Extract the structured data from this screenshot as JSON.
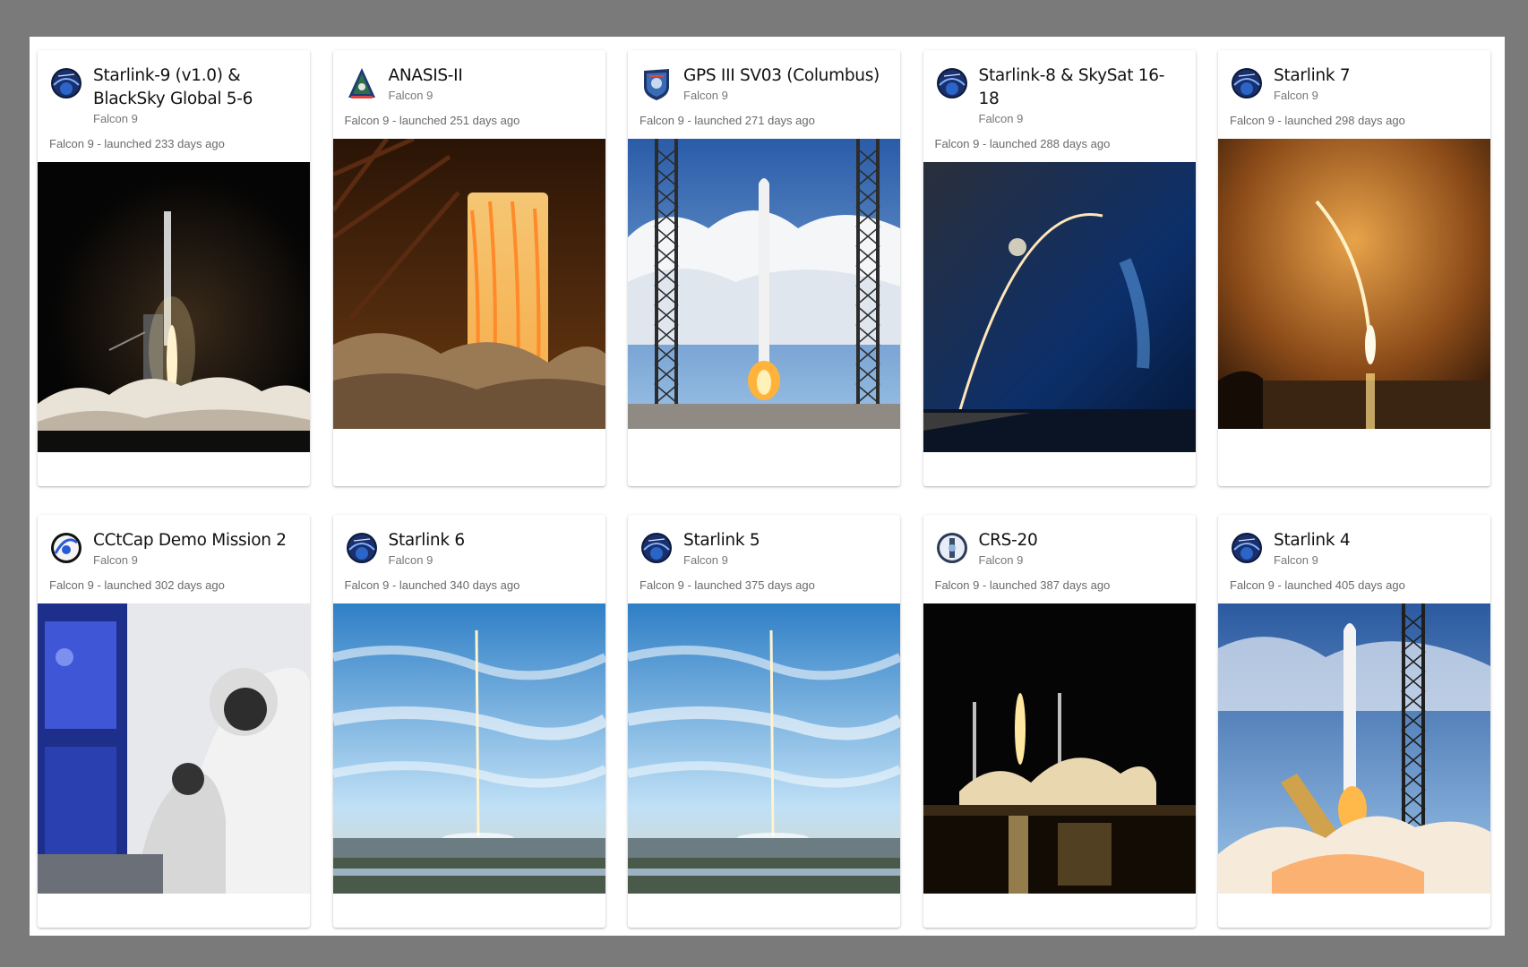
{
  "launches": [
    {
      "title": "Starlink-9 (v1.0) & BlackSky Global 5-6",
      "rocket": "Falcon 9",
      "meta": "Falcon 9 - launched 233 days ago",
      "patch_icon": "starlink-patch-icon",
      "photo": "night-pad-launch"
    },
    {
      "title": "ANASIS-II",
      "rocket": "Falcon 9",
      "meta": "Falcon 9 - launched 251 days ago",
      "patch_icon": "anasis-patch-icon",
      "photo": "engine-fire-closeup"
    },
    {
      "title": "GPS III SV03 (Columbus)",
      "rocket": "Falcon 9",
      "meta": "Falcon 9 - launched 271 days ago",
      "patch_icon": "gps-patch-icon",
      "photo": "day-liftoff-towers"
    },
    {
      "title": "Starlink-8 & SkySat 16-18",
      "rocket": "Falcon 9",
      "meta": "Falcon 9 - launched 288 days ago",
      "patch_icon": "starlink-patch-icon",
      "photo": "dusk-arc"
    },
    {
      "title": "Starlink 7",
      "rocket": "Falcon 9",
      "meta": "Falcon 9 - launched 298 days ago",
      "patch_icon": "starlink-patch-icon",
      "photo": "orange-arc"
    },
    {
      "title": "CCtCap Demo Mission 2",
      "rocket": "Falcon 9",
      "meta": "Falcon 9 - launched 302 days ago",
      "patch_icon": "demo2-patch-icon",
      "photo": "crew-cabin"
    },
    {
      "title": "Starlink 6",
      "rocket": "Falcon 9",
      "meta": "Falcon 9 - launched 340 days ago",
      "patch_icon": "starlink-patch-icon",
      "photo": "blue-sky-trail"
    },
    {
      "title": "Starlink 5",
      "rocket": "Falcon 9",
      "meta": "Falcon 9 - launched 375 days ago",
      "patch_icon": "starlink-patch-icon",
      "photo": "blue-sky-trail"
    },
    {
      "title": "CRS-20",
      "rocket": "Falcon 9",
      "meta": "Falcon 9 - launched 387 days ago",
      "patch_icon": "crs-patch-icon",
      "photo": "night-reflection"
    },
    {
      "title": "Starlink 4",
      "rocket": "Falcon 9",
      "meta": "Falcon 9 - launched 405 days ago",
      "patch_icon": "starlink-patch-icon",
      "photo": "day-liftoff-closeup"
    }
  ]
}
